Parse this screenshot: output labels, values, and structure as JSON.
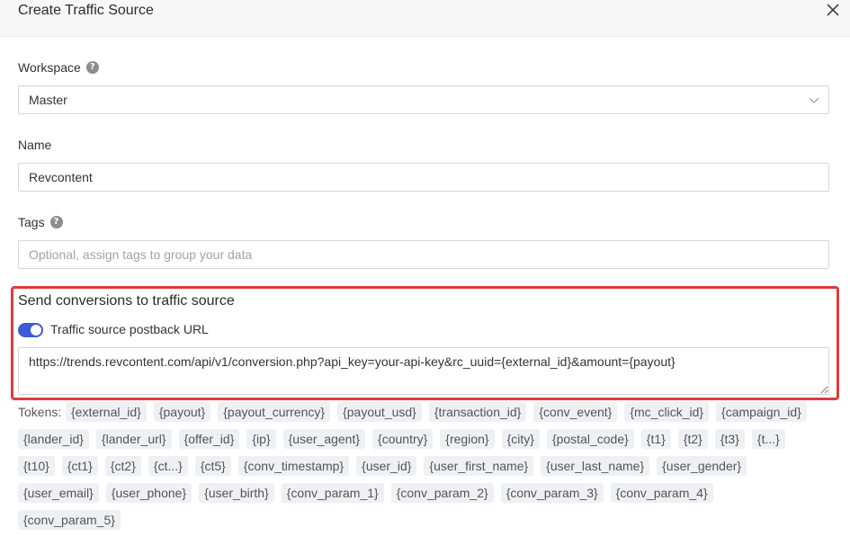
{
  "dialog": {
    "title": "Create Traffic Source"
  },
  "workspace": {
    "label": "Workspace",
    "value": "Master"
  },
  "name": {
    "label": "Name",
    "value": "Revcontent"
  },
  "tags": {
    "label": "Tags",
    "placeholder": "Optional, assign tags to group your data"
  },
  "conversions": {
    "title": "Send conversions to traffic source",
    "toggle_label": "Traffic source postback URL",
    "toggle_on": true,
    "url": "https://trends.revcontent.com/api/v1/conversion.php?api_key=your-api-key&rc_uuid={external_id}&amount={payout}"
  },
  "tokens": {
    "label": "Tokens:",
    "items": [
      "{external_id}",
      "{payout}",
      "{payout_currency}",
      "{payout_usd}",
      "{transaction_id}",
      "{conv_event}",
      "{mc_click_id}",
      "{campaign_id}",
      "{lander_id}",
      "{lander_url}",
      "{offer_id}",
      "{ip}",
      "{user_agent}",
      "{country}",
      "{region}",
      "{city}",
      "{postal_code}",
      "{t1}",
      "{t2}",
      "{t3}",
      "{t...}",
      "{t10}",
      "{ct1}",
      "{ct2}",
      "{ct...}",
      "{ct5}",
      "{conv_timestamp}",
      "{user_id}",
      "{user_first_name}",
      "{user_last_name}",
      "{user_gender}",
      "{user_email}",
      "{user_phone}",
      "{user_birth}",
      "{conv_param_1}",
      "{conv_param_2}",
      "{conv_param_3}",
      "{conv_param_4}",
      "{conv_param_5}"
    ]
  },
  "colors": {
    "accent": "#3c5bd6",
    "highlight": "#e03a3a",
    "token_bg": "#eef0f4"
  }
}
